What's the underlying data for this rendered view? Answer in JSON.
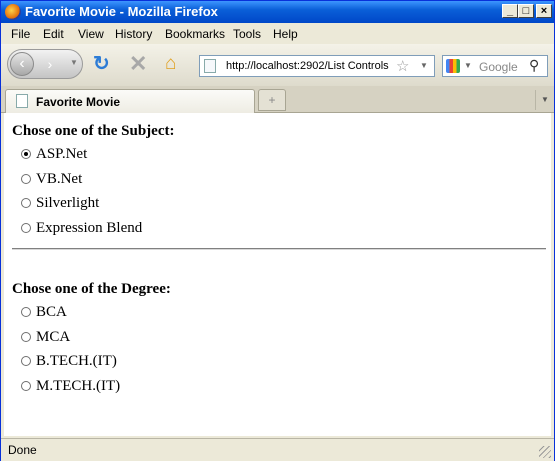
{
  "window": {
    "title": "Favorite Movie - Mozilla Firefox"
  },
  "menu": [
    "File",
    "Edit",
    "View",
    "History",
    "Bookmarks",
    "Tools",
    "Help"
  ],
  "toolbar": {
    "url": "http://localhost:2902/List Controls",
    "search_placeholder": "Google"
  },
  "tabs": [
    {
      "label": "Favorite Movie"
    }
  ],
  "form": {
    "subject_question": "Chose one of the Subject:",
    "subject_options": [
      {
        "label": "ASP.Net",
        "selected": true
      },
      {
        "label": "VB.Net",
        "selected": false
      },
      {
        "label": "Silverlight",
        "selected": false
      },
      {
        "label": "Expression Blend",
        "selected": false
      }
    ],
    "degree_question": "Chose one of the Degree:",
    "degree_options": [
      {
        "label": "BCA",
        "selected": false
      },
      {
        "label": "MCA",
        "selected": false
      },
      {
        "label": "B.TECH.(IT)",
        "selected": false
      },
      {
        "label": "M.TECH.(IT)",
        "selected": false
      }
    ]
  },
  "status": {
    "text": "Done"
  }
}
